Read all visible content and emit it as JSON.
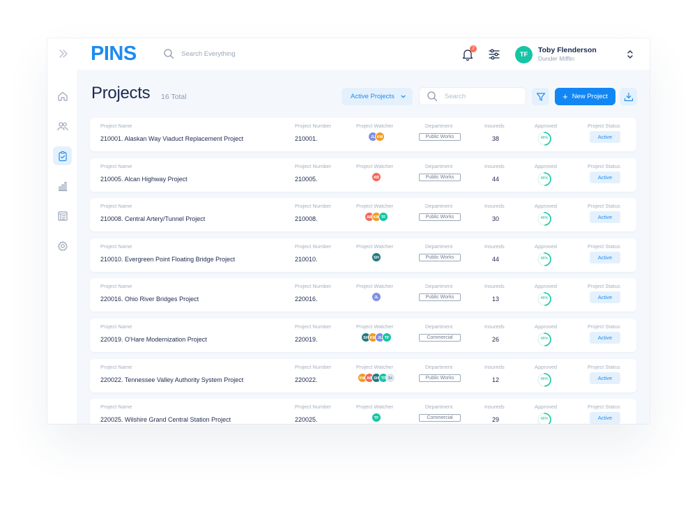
{
  "app": {
    "logo": "PINS"
  },
  "topbar": {
    "search_placeholder": "Search Everything",
    "notification_count": "2",
    "user": {
      "initials": "TF",
      "name": "Toby Flenderson",
      "org": "Dunder Mifflin"
    }
  },
  "page": {
    "title": "Projects",
    "total": "16 Total",
    "filter_label": "Active Projects",
    "search_placeholder": "Search",
    "new_button": "New Project"
  },
  "columns": {
    "name": "Project Name",
    "number": "Project Number",
    "watcher": "Project Watcher",
    "department": "Department",
    "insureds": "Insureds",
    "approved": "Approved",
    "status": "Project Status"
  },
  "colors": {
    "accent": "#1287f4",
    "teal": "#15c5a5",
    "avatar_palette": {
      "JL": "#7f8ee6",
      "KM": "#f29b24",
      "AB": "#f3685a",
      "TF": "#15c5a5",
      "SH": "#1f7a80",
      "3+": "#dfe6f1"
    }
  },
  "projects": [
    {
      "name": "210001. Alaskan Way Viaduct Replacement Project",
      "number": "210001.",
      "watchers": [
        "JL",
        "KM"
      ],
      "department": "Public Works",
      "insureds": "38",
      "approved": "48%",
      "approved_fraction": 0.48,
      "status": "Active"
    },
    {
      "name": "210005. Alcan Highway Project",
      "number": "210005.",
      "watchers": [
        "AB"
      ],
      "department": "Public Works",
      "insureds": "44",
      "approved": "48%",
      "approved_fraction": 0.48,
      "status": "Active"
    },
    {
      "name": "210008. Central Artery/Tunnel Project",
      "number": "210008.",
      "watchers": [
        "AB",
        "KM",
        "TF"
      ],
      "department": "Public Works",
      "insureds": "30",
      "approved": "48%",
      "approved_fraction": 0.48,
      "status": "Active"
    },
    {
      "name": "210010. Evergreen Point Floating Bridge Project",
      "number": "210010.",
      "watchers": [
        "SH"
      ],
      "department": "Public Works",
      "insureds": "44",
      "approved": "48%",
      "approved_fraction": 0.48,
      "status": "Active"
    },
    {
      "name": "220016. Ohio River Bridges Project",
      "number": "220016.",
      "watchers": [
        "JL"
      ],
      "department": "Public Works",
      "insureds": "13",
      "approved": "48%",
      "approved_fraction": 0.48,
      "status": "Active"
    },
    {
      "name": "220019. O'Hare Modernization Project",
      "number": "220019.",
      "watchers": [
        "SH",
        "KM",
        "JL",
        "TF"
      ],
      "department": "Commercial",
      "insureds": "26",
      "approved": "48%",
      "approved_fraction": 0.48,
      "status": "Active"
    },
    {
      "name": "220022. Tennessee Valley Authority System Project",
      "number": "220022.",
      "watchers": [
        "KM",
        "AB",
        "SH",
        "TF",
        "3+"
      ],
      "department": "Public Works",
      "insureds": "12",
      "approved": "48%",
      "approved_fraction": 0.48,
      "status": "Active"
    },
    {
      "name": "220025. Wilshire Grand Central Station Project",
      "number": "220025.",
      "watchers": [
        "TF"
      ],
      "department": "Commercial",
      "insureds": "29",
      "approved": "48%",
      "approved_fraction": 0.48,
      "status": "Active"
    }
  ],
  "sidebar": {
    "items": [
      {
        "icon": "home-icon"
      },
      {
        "icon": "users-icon"
      },
      {
        "icon": "clipboard-check-icon"
      },
      {
        "icon": "bar-chart-icon"
      },
      {
        "icon": "document-list-icon"
      },
      {
        "icon": "gear-icon"
      }
    ]
  }
}
